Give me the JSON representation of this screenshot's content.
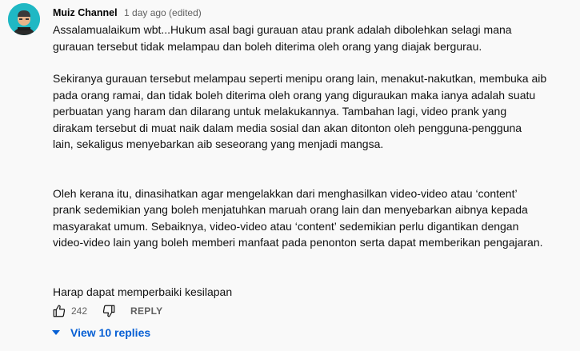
{
  "comment": {
    "author": "Muiz Channel",
    "time": "1 day ago (edited)",
    "paragraphs": [
      "Assalamualaikum wbt...Hukum asal bagi gurauan atau prank adalah dibolehkan selagi mana gurauan tersebut tidak melampau dan boleh diterima oleh orang yang diajak bergurau.",
      "Sekiranya gurauan tersebut melampau seperti menipu orang lain, menakut-nakutkan, membuka aib pada orang ramai, dan tidak boleh diterima oleh orang yang digurauk an maka ianya adalah suatu perbuatan yang haram dan dilarang untuk melakukannya. Tambahan lagi, video prank yang dirakam tersebut di muat naik dalam media sosial dan akan ditonton oleh pengguna-pengguna lain, sekaligus menyebarkan aib seseorang yang menjadi mangsa.",
      "Oleh kerana itu, dinasihatkan agar mengelakkan dari menghasilkan video-video atau ‘content’ prank sedemikian yang boleh menjatuhkan maruah orang lain dan menyebarkan aibnya kepada masyarakat umum. Sebaiknya, video-video atau ‘content’ sedemikian perlu digantikan dengan video-video lain yang boleh memberi manfaat pada penonton serta dapat memberikan pengajaran.",
      "Harap dapat memperbaiki kesilapan"
    ],
    "paragraph_lines": [
      [
        "Assalamualaikum wbt...Hukum asal bagi gurauan atau prank adalah dibolehkan selagi mana",
        "gurauan tersebut tidak melampau dan boleh diterima oleh orang yang diajak bergurau."
      ],
      [
        "Sekiranya gurauan tersebut melampau seperti menipu orang lain, menakut-nakutkan, membuka aib",
        "pada orang ramai, dan tidak boleh diterima oleh orang yang diguraukan maka ianya adalah suatu",
        "perbuatan yang haram dan dilarang untuk melakukannya. Tambahan lagi, video prank yang",
        "dirakam tersebut di muat naik dalam media sosial dan akan ditonton oleh pengguna-pengguna",
        "lain, sekaligus menyebarkan aib seseorang yang menjadi mangsa."
      ],
      [
        "Oleh kerana itu, dinasihatkan agar mengelakkan dari menghasilkan video-video atau ‘content’",
        "prank sedemikian yang boleh menjatuhkan maruah orang lain dan menyebarkan aibnya kepada",
        "masyarakat umum. Sebaiknya, video-video atau ‘content’ sedemikian perlu digantikan dengan",
        "video-video lain yang boleh memberi manfaat pada penonton serta dapat memberikan pengajaran."
      ],
      [
        "Harap dapat memperbaiki kesilapan"
      ]
    ],
    "like_count": "242",
    "reply_label": "REPLY",
    "view_replies_label": "View 10 replies"
  },
  "icons": {
    "like": "thumbs-up-icon",
    "dislike": "thumbs-down-icon",
    "expand": "caret-down-icon"
  },
  "colors": {
    "background": "#f9f9f9",
    "link_blue": "#065fd4",
    "secondary_text": "#606060",
    "avatar_bg": "#1fb8c4"
  }
}
